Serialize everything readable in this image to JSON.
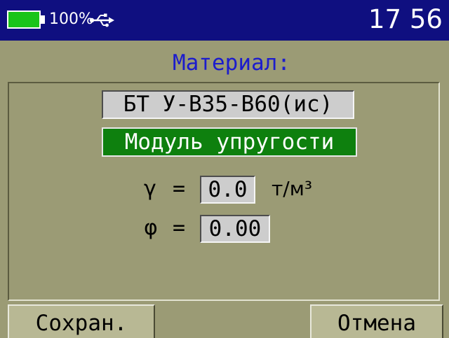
{
  "status_bar": {
    "battery_percent": "100%",
    "battery_level": 1.0,
    "usb_icon": "usb-connection-icon",
    "time": "17 56"
  },
  "title": "Материал:",
  "material": {
    "name": "БТ У-В35-В60(ис)",
    "mode": "Модуль упругости"
  },
  "params": {
    "gamma_symbol": "γ",
    "gamma_eq": "=",
    "gamma_value": "0.0",
    "gamma_unit": "т/м³",
    "phi_symbol": "φ",
    "phi_eq": "=",
    "phi_value": "0.00"
  },
  "buttons": {
    "save": "Сохран.",
    "cancel": "Отмена"
  },
  "colors": {
    "status_bar": "#0f0f80",
    "background": "#9b9b75",
    "title": "#1c1ccc",
    "battery": "#19c419",
    "selected_mode": "#0e800e",
    "field": "#cdcdcd",
    "button": "#b8b894"
  }
}
